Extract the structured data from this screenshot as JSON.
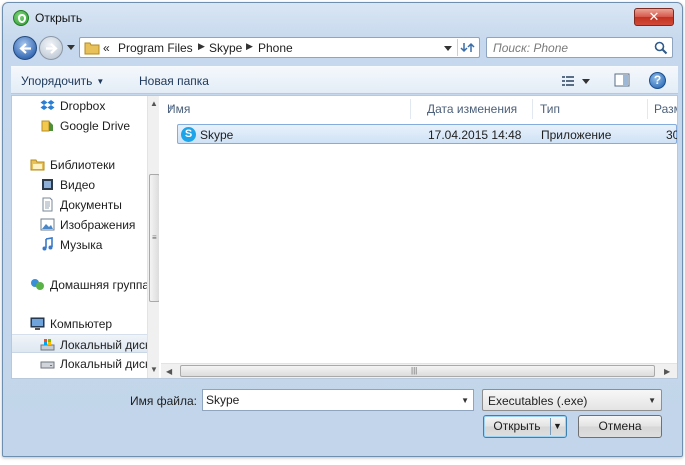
{
  "window": {
    "title": "Открыть"
  },
  "address": {
    "overflow": "«",
    "segments": [
      "Program Files",
      "Skype",
      "Phone"
    ]
  },
  "search": {
    "placeholder": "Поиск: Phone"
  },
  "toolbar": {
    "organize_label": "Упорядочить",
    "new_folder_label": "Новая папка"
  },
  "navigation": [
    {
      "label": "Dropbox",
      "icon": "dropbox-icon"
    },
    {
      "label": "Google Drive",
      "icon": "google-drive-icon"
    },
    {
      "label": "Библиотеки",
      "icon": "libraries-icon"
    },
    {
      "label": "Видео",
      "icon": "video-icon"
    },
    {
      "label": "Документы",
      "icon": "documents-icon"
    },
    {
      "label": "Изображения",
      "icon": "images-icon"
    },
    {
      "label": "Музыка",
      "icon": "music-icon"
    },
    {
      "label": "Домашняя группа",
      "icon": "homegroup-icon"
    },
    {
      "label": "Компьютер",
      "icon": "computer-icon"
    },
    {
      "label": "Локальный диск",
      "icon": "local-disk-icon",
      "selected": true
    },
    {
      "label": "Локальный диск",
      "icon": "local-disk-icon"
    }
  ],
  "columns": [
    "Имя",
    "Дата изменения",
    "Тип",
    "Разм"
  ],
  "files": [
    {
      "name": "Skype",
      "date": "17.04.2015 14:48",
      "type": "Приложение",
      "size": "30",
      "icon": "skype-icon",
      "selected": true
    }
  ],
  "bottom": {
    "filename_label": "Имя файла:",
    "filename_value": "Skype",
    "filter_value": "Executables (.exe)",
    "open_label": "Открыть",
    "cancel_label": "Отмена"
  },
  "colors": {
    "selection": "#cfe2f6",
    "selection_border": "#84acdd",
    "skype": "#1ea4e9",
    "close": "#c2331f"
  }
}
